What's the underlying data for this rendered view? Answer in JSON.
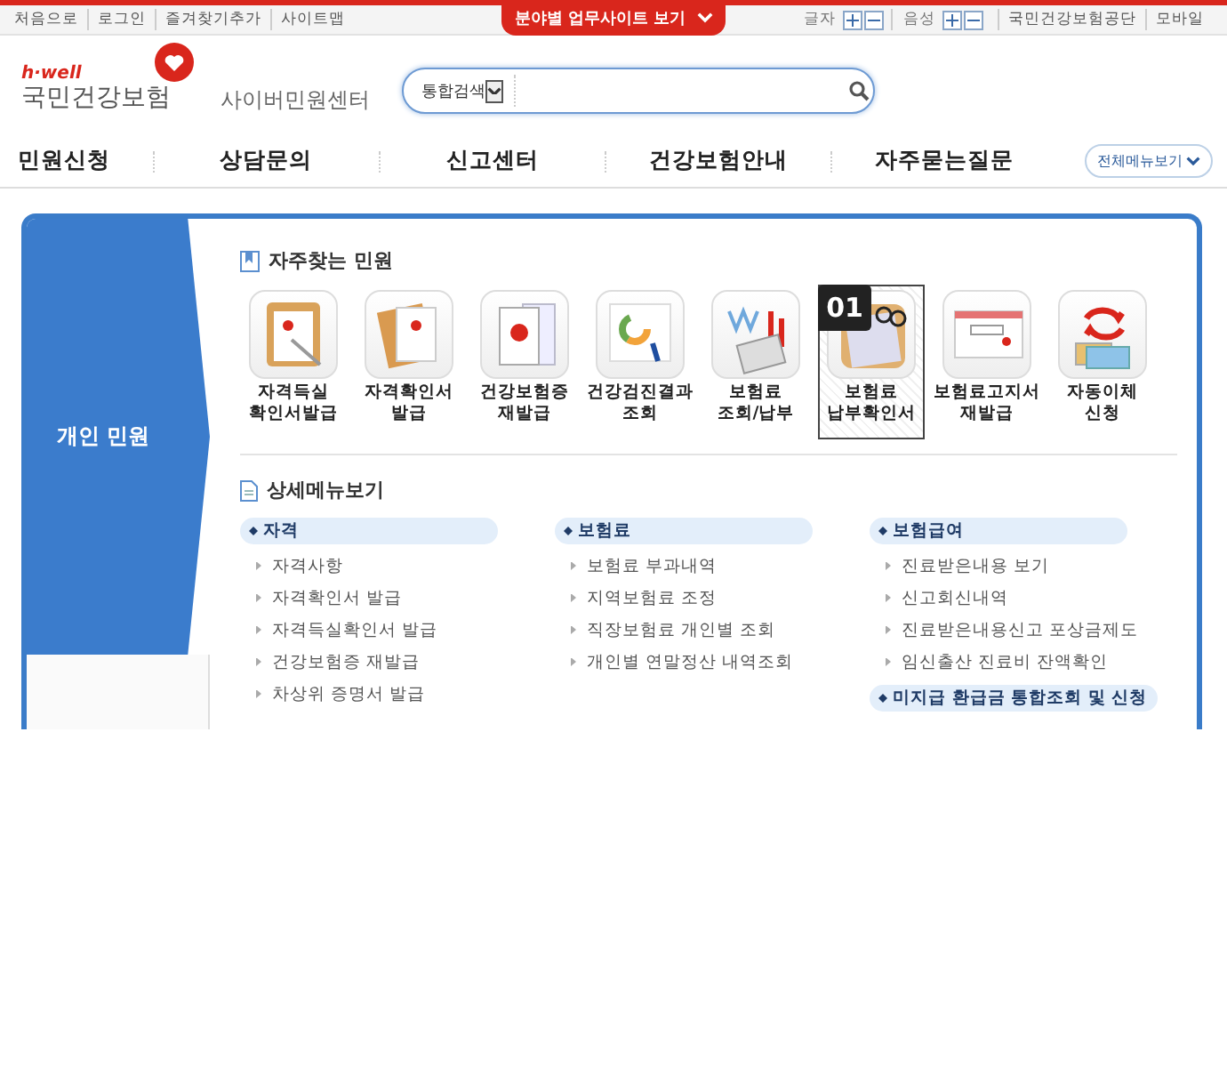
{
  "utility_bar": {
    "left_links": [
      "처음으로",
      "로그인",
      "즐겨찾기추가",
      "사이트맵"
    ],
    "center_tab": "분야별 업무사이트 보기",
    "text_size_label": "글자",
    "voice_label": "음성",
    "right_links": [
      "국민건강보험공단",
      "모바일"
    ]
  },
  "header": {
    "logo_tagline": "h·well",
    "logo_name": "국민건강보험",
    "site_name": "사이버민원센터",
    "search": {
      "scope": "통합검색"
    }
  },
  "nav": {
    "items": [
      "민원신청",
      "상담문의",
      "신고센터",
      "건강보험안내",
      "자주묻는질문"
    ],
    "all_menu": "전체메뉴보기"
  },
  "panel": {
    "tab": "개인 민원",
    "frequent": {
      "title": "자주찾는 민원",
      "items": [
        {
          "lines": [
            "자격득실",
            "확인서발급"
          ],
          "selected": false
        },
        {
          "lines": [
            "자격확인서",
            "발급"
          ],
          "selected": false
        },
        {
          "lines": [
            "건강보험증",
            "재발급"
          ],
          "selected": false
        },
        {
          "lines": [
            "건강검진결과",
            "조회"
          ],
          "selected": false
        },
        {
          "lines": [
            "보험료",
            "조회/납부"
          ],
          "selected": false
        },
        {
          "lines": [
            "보험료",
            "납부확인서"
          ],
          "selected": true,
          "badge": "01"
        },
        {
          "lines": [
            "보험료고지서",
            "재발급"
          ],
          "selected": false
        },
        {
          "lines": [
            "자동이체",
            "신청"
          ],
          "selected": false
        }
      ]
    },
    "detail": {
      "title": "상세메뉴보기",
      "columns": [
        {
          "groups": [
            {
              "heading": "자격",
              "items": [
                "자격사항",
                "자격확인서 발급",
                "자격득실확인서 발급",
                "건강보험증 재발급",
                "차상위 증명서 발급"
              ]
            }
          ]
        },
        {
          "groups": [
            {
              "heading": "보험료",
              "items": [
                "보험료 부과내역",
                "지역보험료 조정",
                "직장보험료 개인별 조회",
                "개인별 연말정산 내역조회"
              ]
            }
          ]
        },
        {
          "groups": [
            {
              "heading": "보험급여",
              "items": [
                "진료받은내용 보기",
                "신고회신내역",
                "진료받은내용신고 포상금제도",
                "임신출산 진료비 잔액확인"
              ]
            },
            {
              "heading": "미지급 환급금 통합조회 및 신청"
            }
          ]
        }
      ]
    }
  }
}
